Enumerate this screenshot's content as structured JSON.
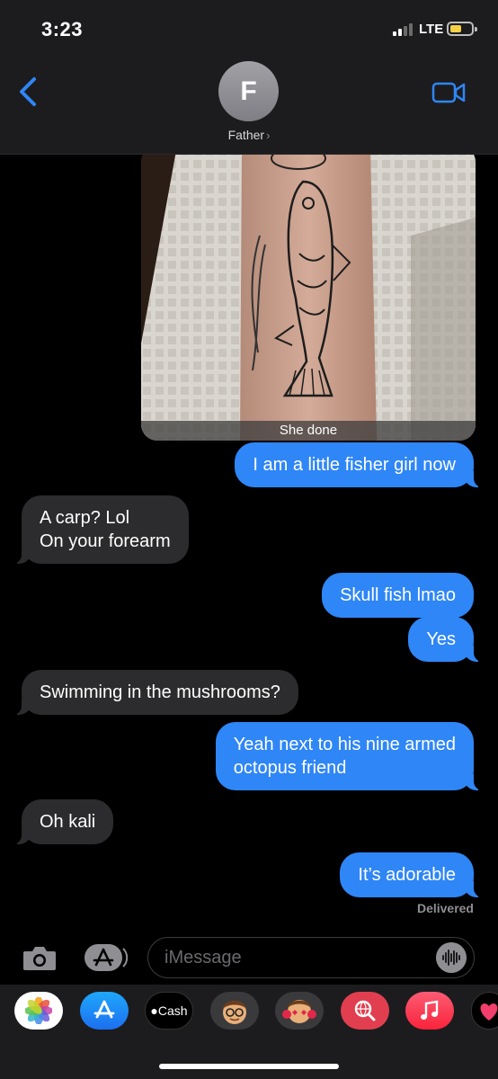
{
  "status_bar": {
    "time": "3:23",
    "network": "LTE"
  },
  "header": {
    "avatar_initial": "F",
    "contact_name": "Father",
    "chevron": "›"
  },
  "photo": {
    "caption": "She done"
  },
  "messages": [
    {
      "from": "me",
      "text": "I am a little fisher girl now"
    },
    {
      "from": "them",
      "lines": [
        "A carp? Lol",
        "On your forearm"
      ]
    },
    {
      "from": "me",
      "text": "Skull fish lmao"
    },
    {
      "from": "me",
      "text": "Yes"
    },
    {
      "from": "them",
      "text": "Swimming in the mushrooms?"
    },
    {
      "from": "me",
      "lines": [
        "Yeah next to his nine armed",
        "octopus friend"
      ]
    },
    {
      "from": "them",
      "text": "Oh kali"
    },
    {
      "from": "me",
      "text": "It’s adorable"
    }
  ],
  "delivery_status": "Delivered",
  "compose": {
    "placeholder": "iMessage"
  },
  "app_drawer": [
    {
      "name": "photos-app-icon"
    },
    {
      "name": "app-store-icon"
    },
    {
      "name": "apple-cash-icon",
      "label": "Cash"
    },
    {
      "name": "memoji-icon"
    },
    {
      "name": "memoji-stickers-icon"
    },
    {
      "name": "web-search-icon"
    },
    {
      "name": "music-icon"
    },
    {
      "name": "digital-touch-icon"
    }
  ],
  "colors": {
    "outgoing_bubble": "#2f86f6",
    "incoming_bubble": "#2c2c2e",
    "accent": "#2f86f6"
  }
}
